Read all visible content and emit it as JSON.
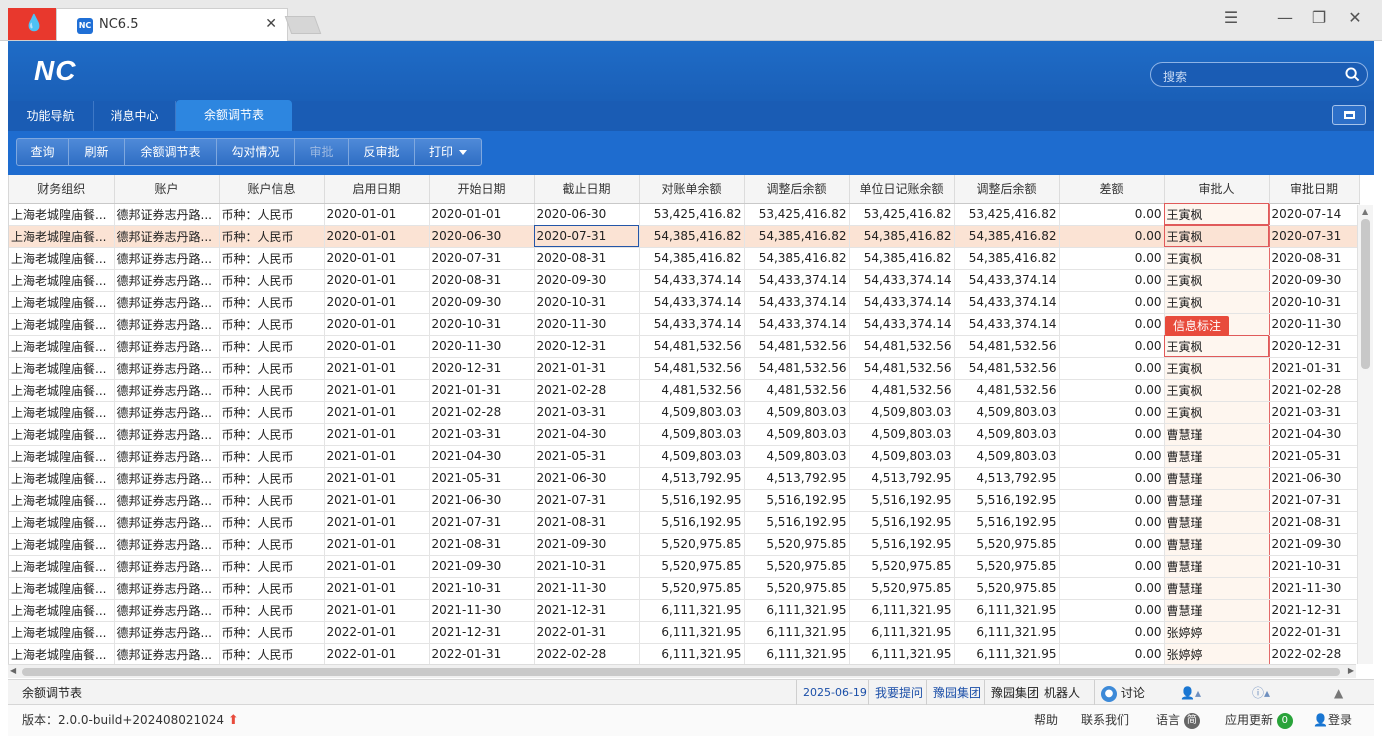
{
  "browser": {
    "tab_title": "NC6.5",
    "tab_icon": "NC"
  },
  "app": {
    "logo": "NC",
    "search_placeholder": "搜索"
  },
  "nav_tabs": [
    {
      "label": "功能导航"
    },
    {
      "label": "消息中心"
    },
    {
      "label": "余额调节表"
    }
  ],
  "toolbar": {
    "buttons": [
      {
        "label": "查询"
      },
      {
        "label": "刷新"
      },
      {
        "label": "余额调节表"
      },
      {
        "label": "勾对情况"
      },
      {
        "label": "审批",
        "disabled": true
      },
      {
        "label": "反审批"
      },
      {
        "label": "打印"
      }
    ]
  },
  "table": {
    "columns": [
      "财务组织",
      "账户",
      "账户信息",
      "启用日期",
      "开始日期",
      "截止日期",
      "对账单余额",
      "调整后余额",
      "单位日记账余额",
      "调整后余额",
      "差额",
      "审批人",
      "审批日期"
    ],
    "rows": [
      [
        "上海老城隍庙餐...",
        "德邦证券志丹路...",
        "币种：人民币",
        "2020-01-01",
        "2020-01-01",
        "2020-06-30",
        "53,425,416.82",
        "53,425,416.82",
        "53,425,416.82",
        "53,425,416.82",
        "0.00",
        "王寅枫",
        "2020-07-14"
      ],
      [
        "上海老城隍庙餐...",
        "德邦证券志丹路...",
        "币种：人民币",
        "2020-01-01",
        "2020-06-30",
        "2020-07-31",
        "54,385,416.82",
        "54,385,416.82",
        "54,385,416.82",
        "54,385,416.82",
        "0.00",
        "王寅枫",
        "2020-07-31"
      ],
      [
        "上海老城隍庙餐...",
        "德邦证券志丹路...",
        "币种：人民币",
        "2020-01-01",
        "2020-07-31",
        "2020-08-31",
        "54,385,416.82",
        "54,385,416.82",
        "54,385,416.82",
        "54,385,416.82",
        "0.00",
        "王寅枫",
        "2020-08-31"
      ],
      [
        "上海老城隍庙餐...",
        "德邦证券志丹路...",
        "币种：人民币",
        "2020-01-01",
        "2020-08-31",
        "2020-09-30",
        "54,433,374.14",
        "54,433,374.14",
        "54,433,374.14",
        "54,433,374.14",
        "0.00",
        "王寅枫",
        "2020-09-30"
      ],
      [
        "上海老城隍庙餐...",
        "德邦证券志丹路...",
        "币种：人民币",
        "2020-01-01",
        "2020-09-30",
        "2020-10-31",
        "54,433,374.14",
        "54,433,374.14",
        "54,433,374.14",
        "54,433,374.14",
        "0.00",
        "王寅枫",
        "2020-10-31"
      ],
      [
        "上海老城隍庙餐...",
        "德邦证券志丹路...",
        "币种：人民币",
        "2020-01-01",
        "2020-10-31",
        "2020-11-30",
        "54,433,374.14",
        "54,433,374.14",
        "54,433,374.14",
        "54,433,374.14",
        "0.00",
        "",
        "2020-11-30"
      ],
      [
        "上海老城隍庙餐...",
        "德邦证券志丹路...",
        "币种：人民币",
        "2020-01-01",
        "2020-11-30",
        "2020-12-31",
        "54,481,532.56",
        "54,481,532.56",
        "54,481,532.56",
        "54,481,532.56",
        "0.00",
        "王寅枫",
        "2020-12-31"
      ],
      [
        "上海老城隍庙餐...",
        "德邦证券志丹路...",
        "币种：人民币",
        "2021-01-01",
        "2020-12-31",
        "2021-01-31",
        "54,481,532.56",
        "54,481,532.56",
        "54,481,532.56",
        "54,481,532.56",
        "0.00",
        "王寅枫",
        "2021-01-31"
      ],
      [
        "上海老城隍庙餐...",
        "德邦证券志丹路...",
        "币种：人民币",
        "2021-01-01",
        "2021-01-31",
        "2021-02-28",
        "4,481,532.56",
        "4,481,532.56",
        "4,481,532.56",
        "4,481,532.56",
        "0.00",
        "王寅枫",
        "2021-02-28"
      ],
      [
        "上海老城隍庙餐...",
        "德邦证券志丹路...",
        "币种：人民币",
        "2021-01-01",
        "2021-02-28",
        "2021-03-31",
        "4,509,803.03",
        "4,509,803.03",
        "4,509,803.03",
        "4,509,803.03",
        "0.00",
        "王寅枫",
        "2021-03-31"
      ],
      [
        "上海老城隍庙餐...",
        "德邦证券志丹路...",
        "币种：人民币",
        "2021-01-01",
        "2021-03-31",
        "2021-04-30",
        "4,509,803.03",
        "4,509,803.03",
        "4,509,803.03",
        "4,509,803.03",
        "0.00",
        "曹慧瑾",
        "2021-04-30"
      ],
      [
        "上海老城隍庙餐...",
        "德邦证券志丹路...",
        "币种：人民币",
        "2021-01-01",
        "2021-04-30",
        "2021-05-31",
        "4,509,803.03",
        "4,509,803.03",
        "4,509,803.03",
        "4,509,803.03",
        "0.00",
        "曹慧瑾",
        "2021-05-31"
      ],
      [
        "上海老城隍庙餐...",
        "德邦证券志丹路...",
        "币种：人民币",
        "2021-01-01",
        "2021-05-31",
        "2021-06-30",
        "4,513,792.95",
        "4,513,792.95",
        "4,513,792.95",
        "4,513,792.95",
        "0.00",
        "曹慧瑾",
        "2021-06-30"
      ],
      [
        "上海老城隍庙餐...",
        "德邦证券志丹路...",
        "币种：人民币",
        "2021-01-01",
        "2021-06-30",
        "2021-07-31",
        "5,516,192.95",
        "5,516,192.95",
        "5,516,192.95",
        "5,516,192.95",
        "0.00",
        "曹慧瑾",
        "2021-07-31"
      ],
      [
        "上海老城隍庙餐...",
        "德邦证券志丹路...",
        "币种：人民币",
        "2021-01-01",
        "2021-07-31",
        "2021-08-31",
        "5,516,192.95",
        "5,516,192.95",
        "5,516,192.95",
        "5,516,192.95",
        "0.00",
        "曹慧瑾",
        "2021-08-31"
      ],
      [
        "上海老城隍庙餐...",
        "德邦证券志丹路...",
        "币种：人民币",
        "2021-01-01",
        "2021-08-31",
        "2021-09-30",
        "5,520,975.85",
        "5,520,975.85",
        "5,516,192.95",
        "5,520,975.85",
        "0.00",
        "曹慧瑾",
        "2021-09-30"
      ],
      [
        "上海老城隍庙餐...",
        "德邦证券志丹路...",
        "币种：人民币",
        "2021-01-01",
        "2021-09-30",
        "2021-10-31",
        "5,520,975.85",
        "5,520,975.85",
        "5,520,975.85",
        "5,520,975.85",
        "0.00",
        "曹慧瑾",
        "2021-10-31"
      ],
      [
        "上海老城隍庙餐...",
        "德邦证券志丹路...",
        "币种：人民币",
        "2021-01-01",
        "2021-10-31",
        "2021-11-30",
        "5,520,975.85",
        "5,520,975.85",
        "5,520,975.85",
        "5,520,975.85",
        "0.00",
        "曹慧瑾",
        "2021-11-30"
      ],
      [
        "上海老城隍庙餐...",
        "德邦证券志丹路...",
        "币种：人民币",
        "2021-01-01",
        "2021-11-30",
        "2021-12-31",
        "6,111,321.95",
        "6,111,321.95",
        "6,111,321.95",
        "6,111,321.95",
        "0.00",
        "曹慧瑾",
        "2021-12-31"
      ],
      [
        "上海老城隍庙餐...",
        "德邦证券志丹路...",
        "币种：人民币",
        "2022-01-01",
        "2021-12-31",
        "2022-01-31",
        "6,111,321.95",
        "6,111,321.95",
        "6,111,321.95",
        "6,111,321.95",
        "0.00",
        "张婷婷",
        "2022-01-31"
      ],
      [
        "上海老城隍庙餐...",
        "德邦证券志丹路...",
        "币种：人民币",
        "2022-01-01",
        "2022-01-31",
        "2022-02-28",
        "6,111,321.95",
        "6,111,321.95",
        "6,111,321.95",
        "6,111,321.95",
        "0.00",
        "张婷婷",
        "2022-02-28"
      ]
    ],
    "highlighted_row": 1
  },
  "tooltip": "信息标注",
  "status_bar": {
    "page_name": "余额调节表",
    "date": "2025-06-19",
    "question": "我要提问",
    "group1": "豫园集团",
    "group2": "豫园集团",
    "robot": "机器人",
    "discuss": "讨论"
  },
  "footer": {
    "version": "版本：2.0.0-build+202408021024",
    "help": "帮助",
    "contact": "联系我们",
    "language": "语言",
    "language_badge": "简",
    "updates": "应用更新",
    "updates_count": "0",
    "login": "登录"
  },
  "colors": {
    "brand_blue": "#1a5fb7",
    "toolbar_blue": "#1e6ccf",
    "highlight_row": "#fbe3d4",
    "approver_border": "#e36a6a",
    "tooltip_red": "#e84b3c",
    "browser_logo_red": "#e8382d"
  }
}
